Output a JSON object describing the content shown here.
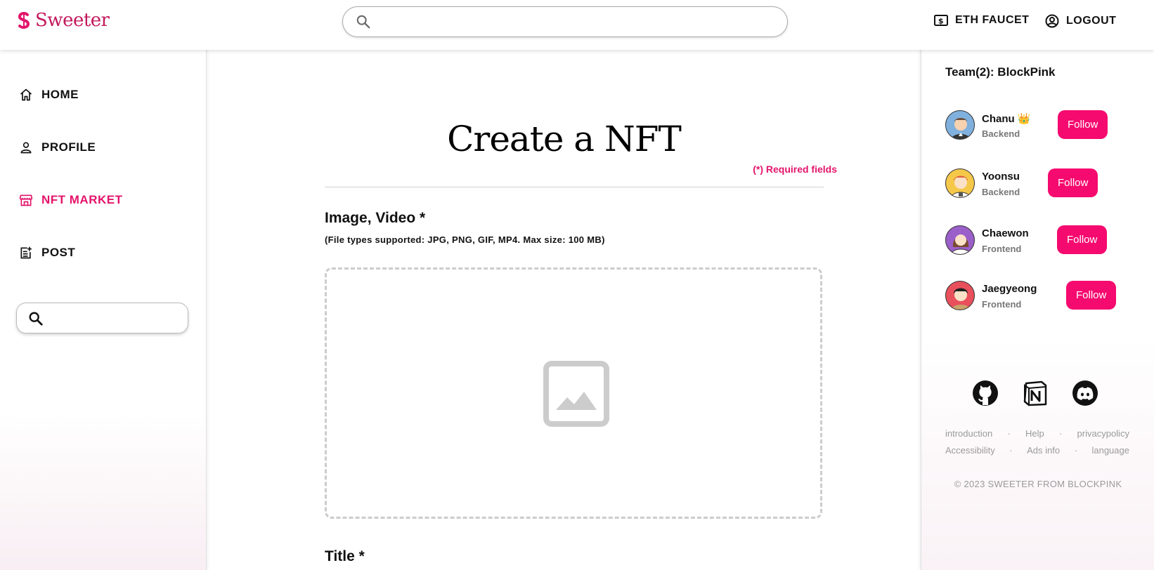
{
  "brand": {
    "name": "Sweeter",
    "accent": "#e3146b"
  },
  "header": {
    "search": {
      "placeholder": "",
      "value": ""
    },
    "faucet_label": "ETH FAUCET",
    "logout_label": "LOGOUT"
  },
  "sidebar": {
    "items": [
      {
        "label": "HOME",
        "icon": "home-icon"
      },
      {
        "label": "PROFILE",
        "icon": "user-icon"
      },
      {
        "label": "NFT MARKET",
        "icon": "store-icon",
        "active": true
      },
      {
        "label": "POST",
        "icon": "post-add-icon"
      }
    ],
    "search": {
      "placeholder": "",
      "value": ""
    }
  },
  "main": {
    "title": "Create a NFT",
    "required_note": "(*) Required fields",
    "media_label": "Image, Video *",
    "media_hint": "(File types supported: JPG, PNG, GIF, MP4. Max size: 100 MB)",
    "title_label": "Title *"
  },
  "team": {
    "title": "Team(2): BlockPink",
    "members": [
      {
        "name": "Chanu 👑",
        "role": "Backend",
        "follow": "Follow"
      },
      {
        "name": "Yoonsu",
        "role": "Backend",
        "follow": "Follow"
      },
      {
        "name": "Chaewon",
        "role": "Frontend",
        "follow": "Follow"
      },
      {
        "name": "Jaegyeong",
        "role": "Frontend",
        "follow": "Follow"
      }
    ]
  },
  "socials": [
    "github-icon",
    "notion-icon",
    "discord-icon"
  ],
  "footer": {
    "links_row1": [
      "introduction",
      "Help",
      "privacypolicy"
    ],
    "links_row2": [
      "Accessibility",
      "Ads info",
      "language"
    ],
    "separator": "·",
    "copyright": "© 2023 SWEETER FROM BLOCKPINK"
  }
}
